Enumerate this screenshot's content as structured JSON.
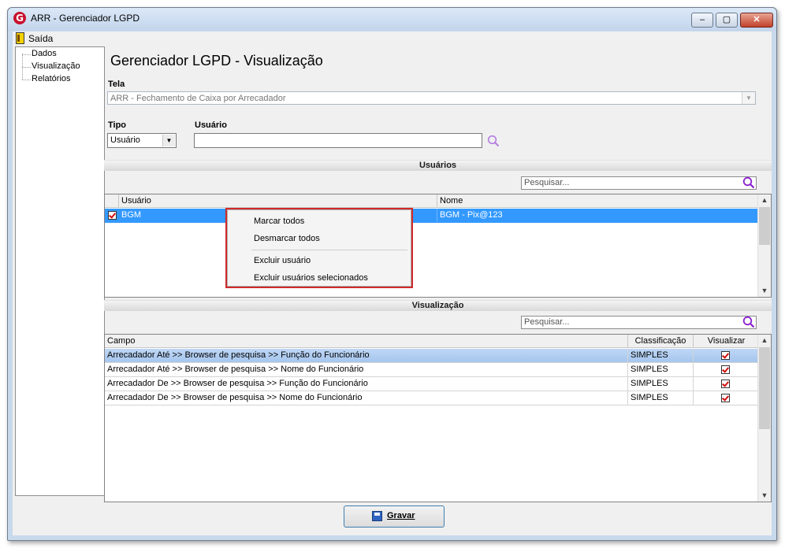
{
  "window": {
    "title": "ARR - Gerenciador LGPD",
    "app_icon": "G",
    "min": "‒",
    "max": "▢",
    "close": "✕"
  },
  "menu": {
    "exit_label": "Saída"
  },
  "tree": {
    "items": [
      "Dados",
      "Visualização",
      "Relatórios"
    ]
  },
  "page": {
    "title": "Gerenciador LGPD - Visualização"
  },
  "tela": {
    "label": "Tela",
    "value": "ARR - Fechamento de Caixa por Arrecadador"
  },
  "tipo": {
    "label": "Tipo",
    "value": "Usuário"
  },
  "usuario": {
    "label": "Usuário",
    "value": ""
  },
  "usuarios_section": {
    "title": "Usuários",
    "search_placeholder": "Pesquisar...",
    "columns": [
      "Usuário",
      "Nome"
    ],
    "rows": [
      {
        "usuario": "BGM",
        "nome": "BGM - Pix@123",
        "checked": true
      }
    ]
  },
  "context_menu": {
    "items": [
      "Marcar todos",
      "Desmarcar todos",
      "Excluir usuário",
      "Excluir usuários selecionados"
    ]
  },
  "visualizacao_section": {
    "title": "Visualização",
    "search_placeholder": "Pesquisar...",
    "columns": [
      "Campo",
      "Classificação",
      "Visualizar"
    ],
    "rows": [
      {
        "campo": "Arrecadador Até >> Browser de pesquisa >> Função do Funcionário",
        "classificacao": "SIMPLES",
        "visualizar": true
      },
      {
        "campo": "Arrecadador Até >> Browser de pesquisa >> Nome do Funcionário",
        "classificacao": "SIMPLES",
        "visualizar": true
      },
      {
        "campo": "Arrecadador De >> Browser de pesquisa >> Função do Funcionário",
        "classificacao": "SIMPLES",
        "visualizar": true
      },
      {
        "campo": "Arrecadador De >> Browser de pesquisa >> Nome do Funcionário",
        "classificacao": "SIMPLES",
        "visualizar": true
      }
    ]
  },
  "footer": {
    "save_label": "Gravar"
  },
  "colors": {
    "selection": "#3399ff",
    "accent": "#9b30d9",
    "check": "#d21010"
  }
}
